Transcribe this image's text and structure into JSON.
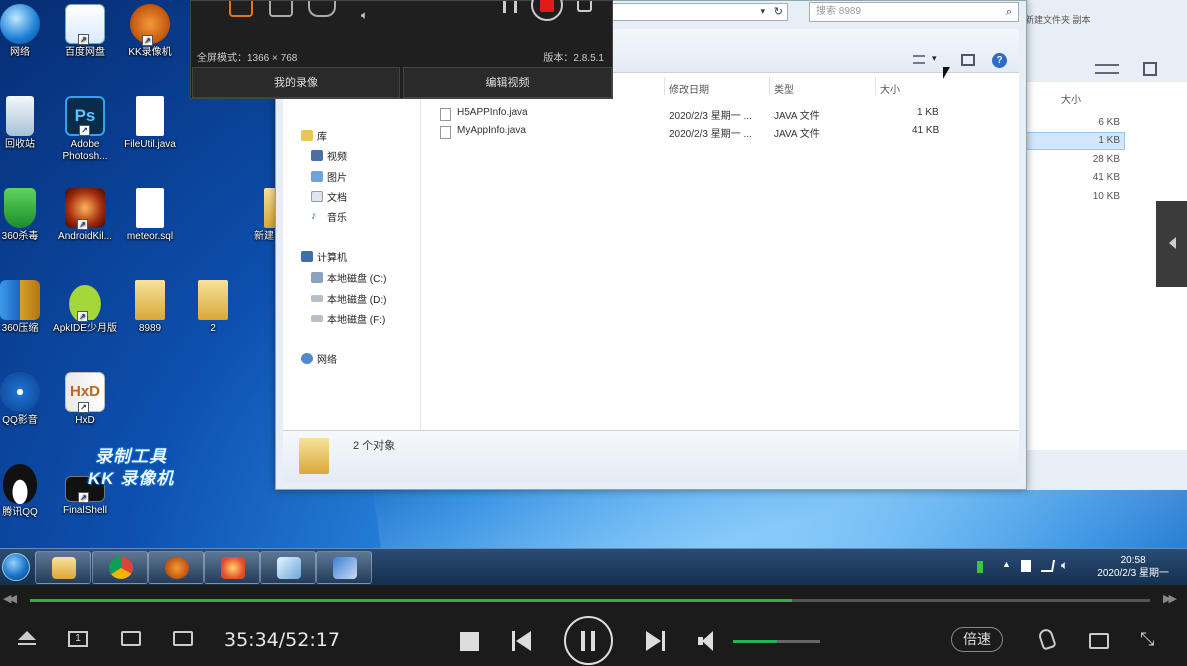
{
  "desktop": {
    "icons": [
      {
        "label": "网络"
      },
      {
        "label": "百度网盘"
      },
      {
        "label": "KK录像机"
      },
      {
        "label": "回收站"
      },
      {
        "label": "Adobe Photosh..."
      },
      {
        "label": "FileUtil.java"
      },
      {
        "label": "360杀毒"
      },
      {
        "label": "AndroidKil..."
      },
      {
        "label": "meteor.sql"
      },
      {
        "label": "360压缩"
      },
      {
        "label": "ApkIDE少月版"
      },
      {
        "label": "8989"
      },
      {
        "label": "2"
      },
      {
        "label": "QQ影音"
      },
      {
        "label": "HxD"
      },
      {
        "label": "腾讯QQ"
      },
      {
        "label": "FinalShell"
      },
      {
        "label": "新建"
      }
    ],
    "watermark": {
      "line1": "录制工具",
      "line2": "KK 录像机"
    }
  },
  "recorder": {
    "resolution": "全屏模式：1366 × 768",
    "version": "版本：2.8.5.1",
    "tab_recordings": "我的录像",
    "tab_edit": "编辑视频"
  },
  "explorer": {
    "search_placeholder": "搜索 8989",
    "columns": {
      "date": "修改日期",
      "type": "类型",
      "size": "大小"
    },
    "nav": {
      "libraries": "库",
      "videos": "视频",
      "pictures": "图片",
      "documents": "文档",
      "music": "音乐",
      "computer": "计算机",
      "drive_c": "本地磁盘 (C:)",
      "drive_d": "本地磁盘 (D:)",
      "drive_f": "本地磁盘 (F:)",
      "network": "网络"
    },
    "files": [
      {
        "name": "H5APPInfo.java",
        "date": "2020/2/3 星期一 ...",
        "type": "JAVA 文件",
        "size": "1 KB"
      },
      {
        "name": "MyAppInfo.java",
        "date": "2020/2/3 星期一 ...",
        "type": "JAVA 文件",
        "size": "41 KB"
      }
    ],
    "status_text": "2 个对象"
  },
  "back_window": {
    "header": "新建文件夹   副本",
    "size_col": "大小",
    "sizes": [
      "6 KB",
      "1 KB",
      "28 KB",
      "41 KB",
      "10 KB"
    ]
  },
  "taskbar": {
    "clock_time": "20:58",
    "clock_date": "2020/2/3 星期一"
  },
  "player": {
    "time": "35:34/52:17",
    "progress": 0.68,
    "volume": 0.5,
    "speed_label": "倍速"
  },
  "colors": {
    "progress": "#25b34b",
    "record_red": "#e31a1a",
    "accent_orange": "#e8741a"
  }
}
